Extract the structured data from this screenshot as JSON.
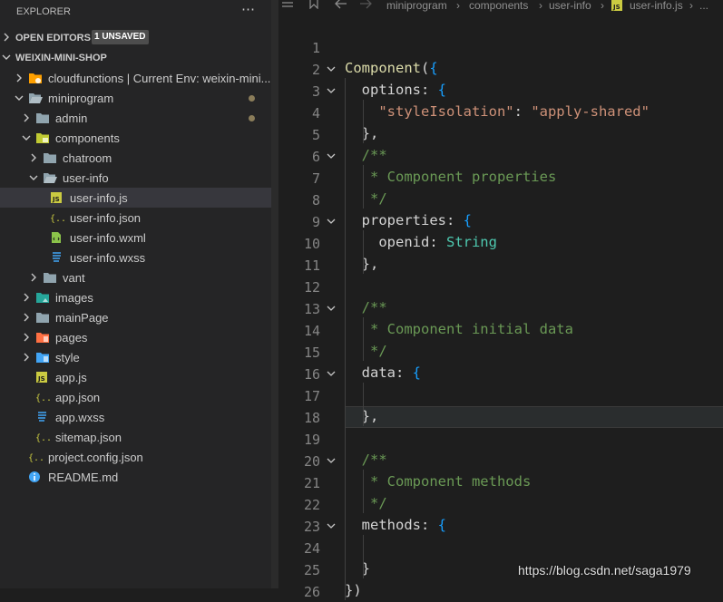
{
  "explorer": {
    "title": "EXPLORER",
    "more_label": "⋯",
    "open_editors": {
      "label": "OPEN EDITORS",
      "badge": "1 UNSAVED"
    },
    "workspace": {
      "label": "WEIXIN-MINI-SHOP"
    }
  },
  "tree": [
    {
      "label": "cloudfunctions | Current Env: weixin-mini...",
      "icon": "cloud-folder-icon"
    },
    {
      "label": "miniprogram",
      "icon": "folder-open-icon",
      "modified": true
    },
    {
      "label": "admin",
      "icon": "folder-icon",
      "modified": true
    },
    {
      "label": "components",
      "icon": "components-folder-icon"
    },
    {
      "label": "chatroom",
      "icon": "folder-icon"
    },
    {
      "label": "user-info",
      "icon": "folder-open-icon"
    },
    {
      "label": "user-info.js",
      "icon": "js-file-icon",
      "active": true
    },
    {
      "label": "user-info.json",
      "icon": "json-file-icon"
    },
    {
      "label": "user-info.wxml",
      "icon": "wxml-file-icon"
    },
    {
      "label": "user-info.wxss",
      "icon": "css-file-icon"
    },
    {
      "label": "vant",
      "icon": "folder-icon"
    },
    {
      "label": "images",
      "icon": "images-folder-icon"
    },
    {
      "label": "mainPage",
      "icon": "folder-icon"
    },
    {
      "label": "pages",
      "icon": "pages-folder-icon"
    },
    {
      "label": "style",
      "icon": "style-folder-icon"
    },
    {
      "label": "app.js",
      "icon": "js-file-icon"
    },
    {
      "label": "app.json",
      "icon": "json-file-icon"
    },
    {
      "label": "app.wxss",
      "icon": "css-file-icon"
    },
    {
      "label": "sitemap.json",
      "icon": "json-file-icon"
    },
    {
      "label": "project.config.json",
      "icon": "json-file-icon"
    },
    {
      "label": "README.md",
      "icon": "info-icon"
    }
  ],
  "breadcrumbs": {
    "bookmark_icon": "bookmark-icon",
    "back_icon": "arrow-left-icon",
    "forward_icon": "arrow-right-icon",
    "items": [
      "miniprogram",
      "components",
      "user-info",
      "user-info.js",
      "..."
    ],
    "separator": "›"
  },
  "editor": {
    "current_line": 18,
    "lines": [
      {
        "n": "1",
        "code": ""
      },
      {
        "n": "2",
        "code": "Component({"
      },
      {
        "n": "3",
        "code": "  options: {"
      },
      {
        "n": "4",
        "code": "    \"styleIsolation\": \"apply-shared\""
      },
      {
        "n": "5",
        "code": "  },"
      },
      {
        "n": "6",
        "code": "  /**"
      },
      {
        "n": "7",
        "code": "   * Component properties"
      },
      {
        "n": "8",
        "code": "   */"
      },
      {
        "n": "9",
        "code": "  properties: {"
      },
      {
        "n": "10",
        "code": "    openid: String"
      },
      {
        "n": "11",
        "code": "  },"
      },
      {
        "n": "12",
        "code": ""
      },
      {
        "n": "13",
        "code": "  /**"
      },
      {
        "n": "14",
        "code": "   * Component initial data"
      },
      {
        "n": "15",
        "code": "   */"
      },
      {
        "n": "16",
        "code": "  data: {"
      },
      {
        "n": "17",
        "code": ""
      },
      {
        "n": "18",
        "code": "  },"
      },
      {
        "n": "19",
        "code": ""
      },
      {
        "n": "20",
        "code": "  /**"
      },
      {
        "n": "21",
        "code": "   * Component methods"
      },
      {
        "n": "22",
        "code": "   */"
      },
      {
        "n": "23",
        "code": "  methods: {"
      },
      {
        "n": "24",
        "code": ""
      },
      {
        "n": "25",
        "code": "  }"
      },
      {
        "n": "26",
        "code": "})"
      }
    ]
  },
  "watermark": "https://blog.csdn.net/saga1979",
  "colors": {
    "background": "#1e1e1e",
    "sidebar": "#252526",
    "active_row": "#37373d",
    "comment": "#6a9955",
    "string": "#ce9178",
    "type": "#4ec9b0",
    "function": "#dcdcaa"
  }
}
